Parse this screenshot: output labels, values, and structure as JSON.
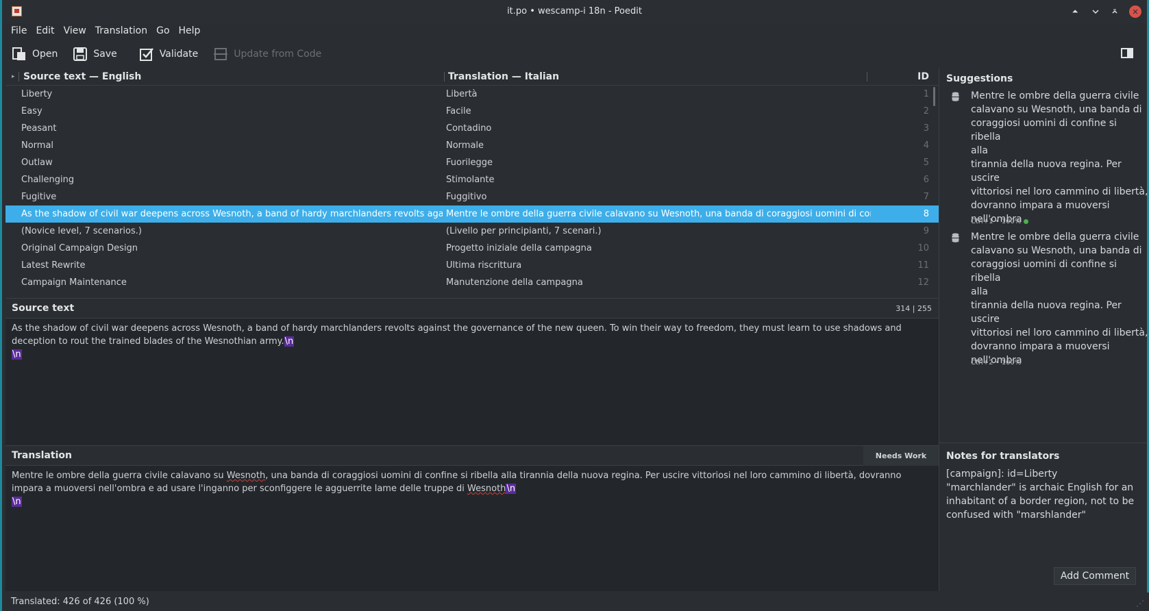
{
  "window": {
    "title": "it.po • wescamp-i 18n - Poedit"
  },
  "menu": [
    "File",
    "Edit",
    "View",
    "Translation",
    "Go",
    "Help"
  ],
  "toolbar": {
    "open": "Open",
    "save": "Save",
    "validate": "Validate",
    "update": "Update from Code"
  },
  "list": {
    "header": {
      "source": "Source text — English",
      "translation": "Translation — Italian",
      "id": "ID"
    },
    "rows": [
      {
        "source": "Liberty",
        "translation": "Libertà",
        "id": "1"
      },
      {
        "source": "Easy",
        "translation": "Facile",
        "id": "2"
      },
      {
        "source": "Peasant",
        "translation": "Contadino",
        "id": "3"
      },
      {
        "source": "Normal",
        "translation": "Normale",
        "id": "4"
      },
      {
        "source": "Outlaw",
        "translation": "Fuorilegge",
        "id": "5"
      },
      {
        "source": "Challenging",
        "translation": "Stimolante",
        "id": "6"
      },
      {
        "source": "Fugitive",
        "translation": "Fuggitivo",
        "id": "7"
      },
      {
        "source": "As the shadow of civil war deepens across Wesnoth, a band of hardy marchlanders revolts against t...",
        "translation": "Mentre le ombre della guerra civile calavano su Wesnoth, una banda di coraggiosi uomini di confin...",
        "id": "8"
      },
      {
        "source": "(Novice level, 7 scenarios.)",
        "translation": "(Livello per principianti, 7 scenari.)",
        "id": "9"
      },
      {
        "source": "Original Campaign Design",
        "translation": "Progetto iniziale della campagna",
        "id": "10"
      },
      {
        "source": "Latest Rewrite",
        "translation": "Ultima riscrittura",
        "id": "11"
      },
      {
        "source": "Campaign Maintenance",
        "translation": "Manutenzione della campagna",
        "id": "12"
      }
    ]
  },
  "source_pane": {
    "title": "Source text",
    "counts": "314 | 255",
    "text": "As the shadow of civil war deepens across Wesnoth, a band of hardy marchlanders revolts against the governance of the new queen. To win their way to freedom, they must learn to use shadows and deception to rout the trained blades of the Wesnothian army.",
    "escape": "\\n"
  },
  "translation_pane": {
    "title": "Translation",
    "status": "Needs Work",
    "text_a": "Mentre le ombre della guerra civile calavano su ",
    "word_1": "Wesnoth",
    "text_b": ", una banda di coraggiosi uomini di confine si ribella alla tirannia della nuova regina. Per uscire vittoriosi nel loro cammino di libertà, dovranno impara a muoversi nell'ombra e ad usare l'inganno per sconfiggere le agguerrite lame delle truppe di ",
    "word_2": "Wesnoth",
    "escape": "\\n"
  },
  "sidebar": {
    "suggestions_title": "Suggestions",
    "suggestions": [
      {
        "text": "Mentre le ombre della guerra civile\ncalavano su Wesnoth, una banda di\ncoraggiosi uomini di confine si ribella\nalla\ntirannia della nuova regina. Per\nuscire\nvittoriosi nel loro cammino di libertà,\ndovranno impara a muoversi\nnell'ombra",
        "meta": "Ctrl+1 • 100%"
      },
      {
        "text": "Mentre le ombre della guerra civile\ncalavano su Wesnoth, una banda di\ncoraggiosi uomini di confine si ribella\nalla\ntirannia della nuova regina. Per\nuscire\nvittoriosi nel loro cammino di libertà,\ndovranno impara a muoversi\nnell'ombra",
        "meta": "Ctrl+2 • 100%"
      }
    ],
    "notes_title": "Notes for translators",
    "notes_line1": "[campaign]: id=Liberty",
    "notes_line2": "\"marchlander\" is archaic English for an inhabitant of a border region, not to be confused with \"marshlander\"",
    "add_comment": "Add Comment"
  },
  "status": {
    "text": "Translated: 426 of 426 (100 %)"
  },
  "colors": {
    "accent": "#3daee9",
    "frame": "#1d8a9e",
    "escape": "#5b2c9a",
    "ok": "#4caf50"
  }
}
